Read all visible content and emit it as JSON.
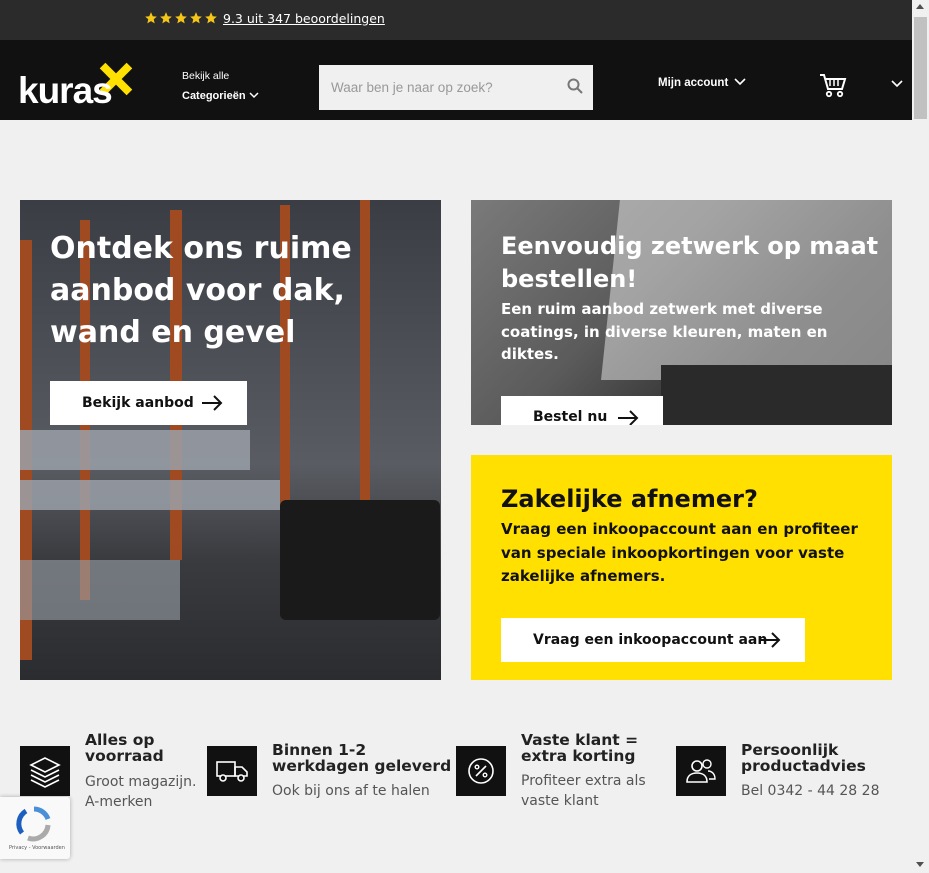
{
  "topbar": {
    "rating_stars": 5,
    "rating_text": "9.3 uit 347 beoordelingen",
    "star_color": "#f5c518"
  },
  "header": {
    "logo_text": "kuras",
    "categories_small": "Bekijk alle",
    "categories_bold": "Categorieën",
    "search_placeholder": "Waar ben je naar op zoek?",
    "account_label": "Mijn account"
  },
  "hero_left": {
    "title": "Ontdek ons ruime aanbod voor dak, wand en gevel",
    "button": "Bekijk aanbod"
  },
  "hero_right": {
    "title": "Eenvoudig zetwerk op maat bestellen!",
    "subtitle": "Een ruim aanbod zetwerk met diverse coatings, in diverse kleuren, maten en diktes.",
    "button": "Bestel nu"
  },
  "business": {
    "title": "Zakelijke afnemer?",
    "subtitle": "Vraag een inkoopaccount aan en profiteer van speciale inkoopkortingen voor vaste zakelijke afnemers.",
    "button": "Vraag een inkoopaccount aan",
    "color": "#ffe000"
  },
  "features": [
    {
      "icon": "layers-icon",
      "title": "Alles op voorraad",
      "subtitle": "Groot magazijn. A-merken"
    },
    {
      "icon": "truck-icon",
      "title": "Binnen 1-2 werkdagen geleverd",
      "subtitle": "Ook bij ons af te halen"
    },
    {
      "icon": "percent-icon",
      "title": "Vaste klant = extra korting",
      "subtitle": "Profiteer extra als vaste klant"
    },
    {
      "icon": "people-icon",
      "title": "Persoonlijk productadvies",
      "subtitle": "Bel 0342 - 44 28 28"
    }
  ],
  "recaptcha": {
    "text": "Privacy - Voorwaarden"
  }
}
